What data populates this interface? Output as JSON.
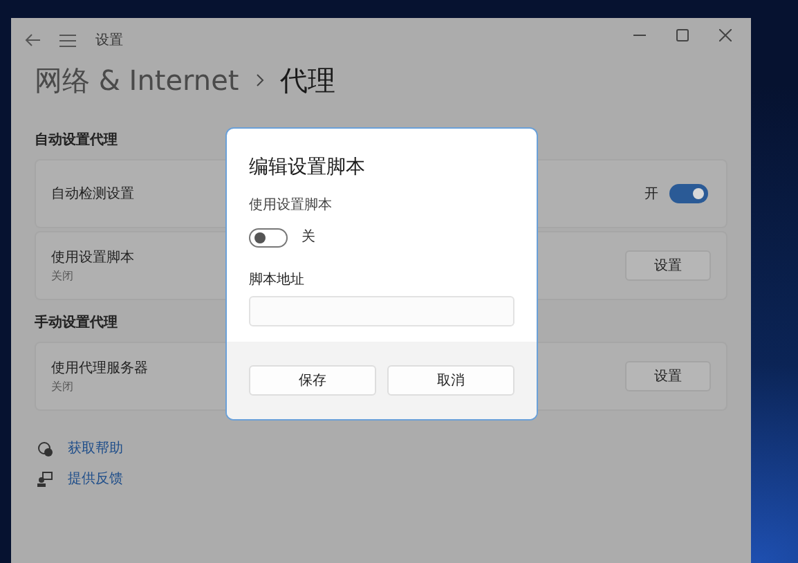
{
  "window": {
    "title": "设置",
    "breadcrumb": [
      {
        "label": "网络 & Internet",
        "selected": false
      },
      {
        "label": "代理",
        "selected": true
      }
    ]
  },
  "sections": [
    {
      "heading": "自动设置代理",
      "rows": [
        {
          "kind": "toggle",
          "title": "自动检测设置",
          "state_label": "开",
          "on": true
        },
        {
          "kind": "button",
          "title": "使用设置脚本",
          "subtitle": "关闭",
          "button": "设置"
        }
      ]
    },
    {
      "heading": "手动设置代理",
      "rows": [
        {
          "kind": "button",
          "title": "使用代理服务器",
          "subtitle": "关闭",
          "button": "设置"
        }
      ]
    }
  ],
  "links": [
    {
      "kind": "help",
      "label": "获取帮助"
    },
    {
      "kind": "feedback",
      "label": "提供反馈"
    }
  ],
  "dialog": {
    "title": "编辑设置脚本",
    "toggle_label": "使用设置脚本",
    "toggle": {
      "on": false,
      "state_label": "关"
    },
    "field_label": "脚本地址",
    "buttons": [
      "保存",
      "取消"
    ]
  }
}
